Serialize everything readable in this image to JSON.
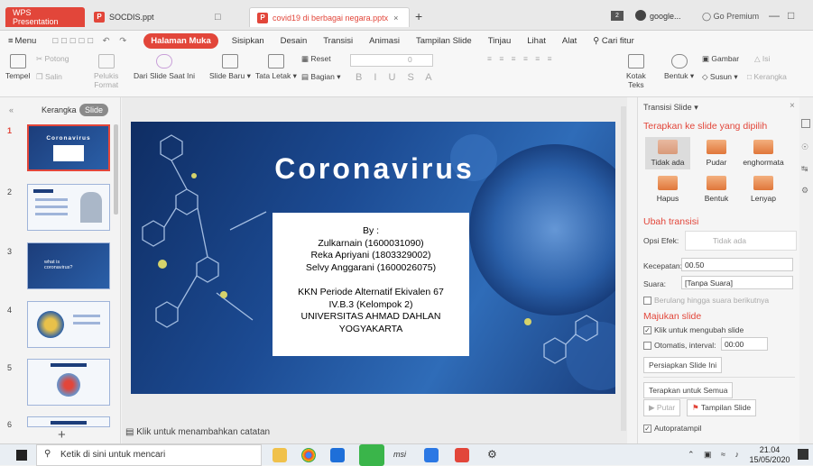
{
  "tabs": {
    "wps": "WPS Presentation",
    "socdis": "SOCDIS.ppt",
    "covid": "covid19 di berbagai negara.pptx",
    "search_app": "google...",
    "go_premium": "Go Premium"
  },
  "menu": {
    "menu_label": "Menu",
    "items": [
      "Halaman Muka",
      "Sisipkan",
      "Desain",
      "Transisi",
      "Animasi",
      "Tampilan Slide",
      "Tinjau",
      "Lihat",
      "Alat"
    ],
    "search": "Cari fitur"
  },
  "ribbon": {
    "tempel": "Tempel",
    "potong": "Potong",
    "salin": "Salin",
    "pelukis": "Pelukis",
    "format": "Format",
    "dari_slide": "Dari Slide Saat Ini",
    "slide_baru": "Slide Baru",
    "tata_letak": "Tata Letak",
    "reset": "Reset",
    "bagian": "Bagian",
    "font_size": "0",
    "kotak_teks": "Kotak",
    "teks": "Teks",
    "bentuk": "Bentuk",
    "gambar": "Gambar",
    "isi": "Isi",
    "susun": "Susun",
    "kerangka": "Kerangka"
  },
  "leftpanel": {
    "kerangka": "Kerangka",
    "slide": "Slide",
    "numbers": [
      "1",
      "2",
      "3",
      "4",
      "5",
      "6"
    ],
    "thumb1_title": "Coronavirus",
    "thumb3_title": "what is coronavirus?",
    "add": "+"
  },
  "slide": {
    "title": "Coronavirus",
    "by": "By :",
    "author1": "Zulkarnain (1600031090)",
    "author2": "Reka Apriyani (1803329002)",
    "author3": "Selvy Anggarani (1600026075)",
    "line1": "KKN Periode Alternatif Ekivalen 67",
    "line2": "IV.B.3 (Kelompok 2)",
    "line3": "UNIVERSITAS AHMAD DAHLAN",
    "line4": "YOGYAKARTA"
  },
  "notes": "Klik untuk menambahkan catatan",
  "pane": {
    "title": "Transisi Slide",
    "apply_selected": "Terapkan ke slide yang dipilih",
    "transitions": [
      "Tidak ada",
      "Pudar",
      "enghormata",
      "Hapus",
      "Bentuk",
      "Lenyap"
    ],
    "ubah": "Ubah transisi",
    "opsi_efek": "Opsi Efek:",
    "opsi_value": "Tidak ada",
    "kecepatan": "Kecepatan:",
    "kecepatan_value": "00.50",
    "suara": "Suara:",
    "suara_value": "[Tanpa Suara]",
    "berulang": "Berulang hingga suara berikutnya",
    "majukan": "Majukan slide",
    "klik": "Klik untuk mengubah slide",
    "otomatis": "Otomatis, interval:",
    "interval": "00:00",
    "persiapkan": "Persiapkan Slide Ini",
    "terapkan_semua": "Terapkan untuk Semua",
    "putar": "Putar",
    "tampilan_slide": "Tampilan Slide",
    "autopratampil": "Autopratampil"
  },
  "taskbar": {
    "search": "Ketik di sini untuk mencari",
    "time": "21.04",
    "date": "15/05/2020",
    "msi": "msi"
  },
  "colors": {
    "accent": "#e2463a",
    "slide_bg": "#1c4b93"
  }
}
